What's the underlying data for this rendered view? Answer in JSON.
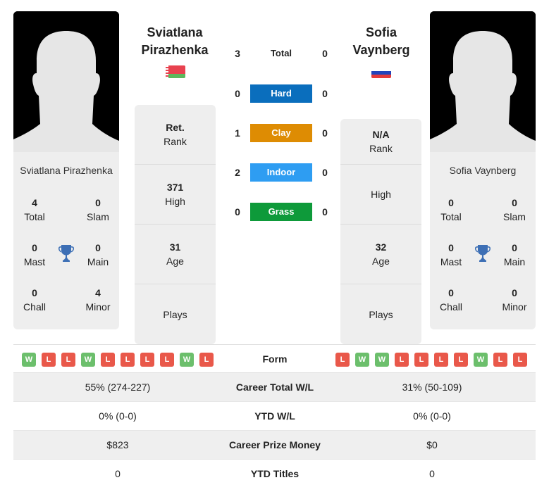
{
  "player1": {
    "name_line1": "Sviatlana",
    "name_line2": "Pirazhenka",
    "full_name": "Sviatlana Pirazhenka",
    "flag": "belarus-flag",
    "titles": {
      "total": "4",
      "total_label": "Total",
      "slam": "0",
      "slam_label": "Slam",
      "mast": "0",
      "mast_label": "Mast",
      "main": "0",
      "main_label": "Main",
      "chall": "0",
      "chall_label": "Chall",
      "minor": "4",
      "minor_label": "Minor"
    },
    "rank": "Ret.",
    "rank_label": "Rank",
    "high": "371",
    "high_label": "High",
    "age": "31",
    "age_label": "Age",
    "plays": "",
    "plays_label": "Plays",
    "form": [
      "W",
      "L",
      "L",
      "W",
      "L",
      "L",
      "L",
      "L",
      "W",
      "L"
    ]
  },
  "player2": {
    "name_line1": "Sofia",
    "name_line2": "Vaynberg",
    "full_name": "Sofia Vaynberg",
    "flag": "russia-flag",
    "titles": {
      "total": "0",
      "total_label": "Total",
      "slam": "0",
      "slam_label": "Slam",
      "mast": "0",
      "mast_label": "Mast",
      "main": "0",
      "main_label": "Main",
      "chall": "0",
      "chall_label": "Chall",
      "minor": "0",
      "minor_label": "Minor"
    },
    "rank": "N/A",
    "rank_label": "Rank",
    "high": "",
    "high_label": "High",
    "age": "32",
    "age_label": "Age",
    "plays": "",
    "plays_label": "Plays",
    "form": [
      "L",
      "W",
      "W",
      "L",
      "L",
      "L",
      "L",
      "W",
      "L",
      "L"
    ]
  },
  "h2h": {
    "total": {
      "label": "Total",
      "p1": "3",
      "p2": "0"
    },
    "surfaces": [
      {
        "label": "Hard",
        "p1": "0",
        "p2": "0",
        "color": "#0a6ebd"
      },
      {
        "label": "Clay",
        "p1": "1",
        "p2": "0",
        "color": "#de8c03"
      },
      {
        "label": "Indoor",
        "p1": "2",
        "p2": "0",
        "color": "#2e9df2"
      },
      {
        "label": "Grass",
        "p1": "0",
        "p2": "0",
        "color": "#0e9a3a"
      }
    ]
  },
  "colors": {
    "win": "#6cbf6c",
    "loss": "#e9584a",
    "trophy": "#3d6fb5"
  },
  "form_label": "Form",
  "stats": [
    {
      "label": "Career Total W/L",
      "p1": "55% (274-227)",
      "p2": "31% (50-109)"
    },
    {
      "label": "YTD W/L",
      "p1": "0% (0-0)",
      "p2": "0% (0-0)"
    },
    {
      "label": "Career Prize Money",
      "p1": "$823",
      "p2": "$0"
    },
    {
      "label": "YTD Titles",
      "p1": "0",
      "p2": "0"
    }
  ]
}
